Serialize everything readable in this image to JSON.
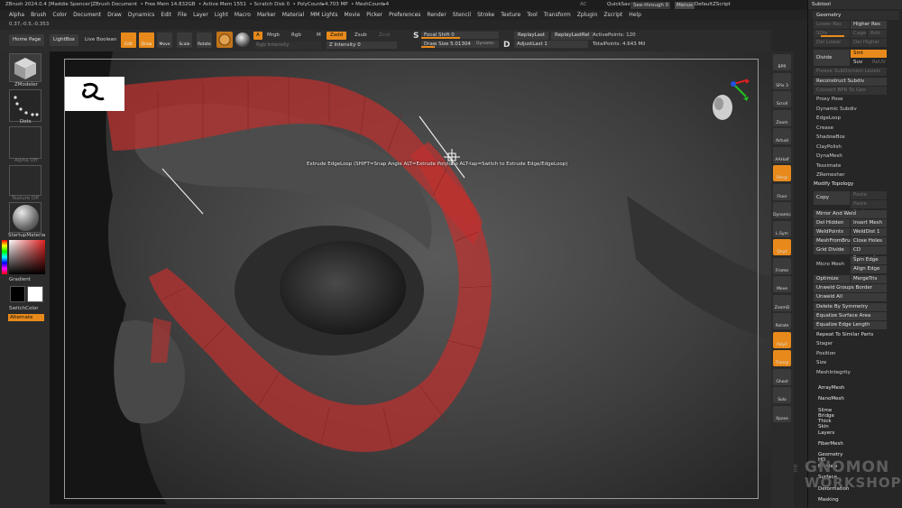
{
  "app_title": "ZBrush 2024.0.4 [Maddie Spencer]ZBrush Document",
  "mem_stats": {
    "free_mem": "Free Mem 14.832GB",
    "active_mem": "Active Mem 1551",
    "scratch_disk": "Scratch Disk 0",
    "poly_count": "PolyCount▸4.703 MP",
    "mesh_count": "MeshCount▸4"
  },
  "top_right": {
    "ac": "AC",
    "quicksave": "QuickSave",
    "see_through": "See-through",
    "see_through_value": "0",
    "menus": "Menus",
    "default_script": "DefaultZScript"
  },
  "menu_items": [
    "Alpha",
    "Brush",
    "Color",
    "Document",
    "Draw",
    "Dynamics",
    "Edit",
    "File",
    "Layer",
    "Light",
    "Macro",
    "Marker",
    "Material",
    "MM Lights",
    "Movie",
    "Picker",
    "Preferences",
    "Render",
    "Stencil",
    "Stroke",
    "Texture",
    "Tool",
    "Transform",
    "Zplugin",
    "Zscript",
    "Help"
  ],
  "coords": "0.37,-0.5,-0.353",
  "toolbar": {
    "home_page": "Home Page",
    "lightbox": "LightBox",
    "live_boolean": "Live Boolean",
    "edit": "Edit",
    "draw": "Draw",
    "move": "Move",
    "scale": "Scale",
    "rotate": "Rotate",
    "a": "A",
    "mrgb": "Mrgb",
    "rgb": "Rgb",
    "m": "M",
    "zadd": "Zadd",
    "zsub": "Zsub",
    "zcut": "Zcut",
    "rgb_intensity": "Rgb Intensity",
    "z_intensity": "Z Intensity 0",
    "focal_shift": "Focal Shift",
    "focal_shift_value": "0",
    "draw_size": "Draw Size",
    "draw_size_value": "5.01304",
    "dynamic": "Dynamic",
    "replay_last": "ReplayLast",
    "replay_last_rel": "ReplayLastRel",
    "adjust_last": "AdjustLast",
    "adjust_last_value": "1",
    "active_points": "ActivePoints: 120",
    "total_points": "TotalPoints: 4.643 Mil",
    "s": "S",
    "d": "D"
  },
  "left_panel": {
    "zmodeler": "ZModeler",
    "dots": "Dots",
    "alpha_off": "Alpha Off",
    "texture_off": "Texture Off",
    "material": "StartupMateria",
    "gradient": "Gradient",
    "switch_color": "SwitchColor",
    "alternate": "Alternate"
  },
  "viewport": {
    "tooltip": "Extrude EdgeLoop (SHIFT=Snap Angle   ALT=Extrude Polyloop   ALT-tap=Switch to Extrude Edge/EdgeLoop)"
  },
  "right_shelf": [
    "BPR",
    "SPix 3",
    "Scroll",
    "Zoom",
    "Actual",
    "AAHalf",
    "Persp",
    "Floor",
    "Dynamic",
    "L.Sym",
    "Qxyz",
    "Frame",
    "Move",
    "ZoomD",
    "Rotate",
    "PolyF",
    "Transp",
    "Ghost",
    "Solo",
    "Xpose"
  ],
  "palette": {
    "subtool": "Subtool",
    "geometry": "Geometry",
    "lower_res": "Lower Res",
    "higher_res": "Higher Res",
    "sdiv": "SDiv",
    "cage": "Cage",
    "rstr": "Rstr",
    "del_lower": "Del Lower",
    "del_higher": "Del Higher",
    "divide": "Divide",
    "smt": "Smt",
    "suv": "Suv",
    "reuv": "ReUV",
    "freeze_subdiv": "Freeze SubDivision Levels",
    "reconstruct_subdiv": "Reconstruct Subdiv",
    "convert_bpr": "Convert BPR To Geo",
    "proxy_pose": "Proxy Pose",
    "dynamic_subdiv": "Dynamic Subdiv",
    "geometry_items": [
      "EdgeLoop",
      "Crease",
      "ShadowBox",
      "ClayPolish",
      "DynaMesh",
      "Tessimate",
      "ZRemesher"
    ],
    "modify_topology": "Modify Topology",
    "copy": "Copy",
    "paste_append": "Paste Append",
    "paste_replace": "Paste Replace",
    "mirror_and_weld": "Mirror And Weld",
    "del_hidden": "Del Hidden",
    "insert_mesh": "Insert Mesh",
    "weld_points": "WeldPoints",
    "weld_dist": "WeldDist 1",
    "mesh_from_brush": "MeshFromBrush",
    "close_holes": "Close Holes",
    "grid_divide": "Grid Divide",
    "cd_segments": "CD Segments",
    "spin_edge": "Spin Edge",
    "micro_mesh": "Micro Mesh",
    "align_edge": "Align Edge",
    "optimize_point": "Optimize Point",
    "merge_tris": "MergeTris",
    "unweld_groups_border": "Unweld Groups Border",
    "unweld_all": "Unweld All",
    "delete_by_symmetry": "Delete By Symmetry",
    "equalize_surface_area": "Equalize Surface Area",
    "equalize_edge_length": "Equalize Edge Length",
    "repeat_to_similar": "Repeat To Similar Parts",
    "bottom_items": [
      "Stager",
      "Position",
      "Size",
      "MeshIntegrity"
    ],
    "subpalettes": [
      "ArrayMesh",
      "NanoMesh",
      "Slime Bridge",
      "Thick Skin",
      "Layers",
      "FiberMesh",
      "Geometry HD",
      "Preview",
      "Surface",
      "Deformation",
      "Masking"
    ]
  },
  "watermark": {
    "the": "THE",
    "line1": "GNOMON",
    "line2": "WORKSHOP"
  },
  "colors": {
    "accent": "#e88a1b",
    "mesh_highlight": "#c0302e",
    "background": "#262626"
  }
}
